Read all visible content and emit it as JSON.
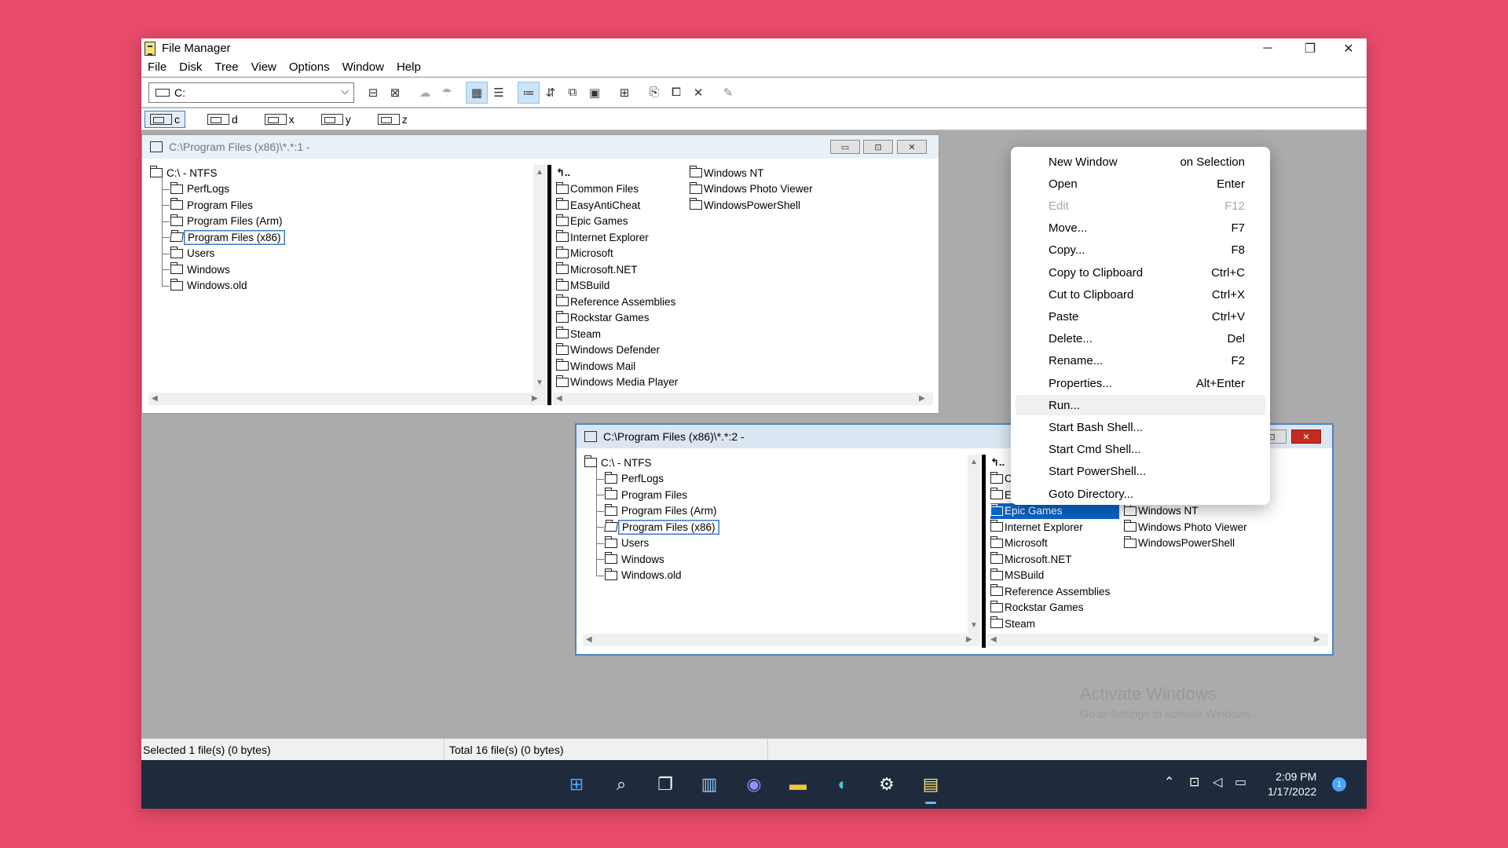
{
  "app": {
    "title": "File Manager",
    "window_controls": {
      "minimize": "─",
      "maximize": "❐",
      "close": "✕"
    }
  },
  "menubar": [
    "File",
    "Disk",
    "Tree",
    "View",
    "Options",
    "Window",
    "Help"
  ],
  "toolbar": {
    "drive_value": "C:",
    "buttons": [
      "connect-drive-icon",
      "disconnect-drive-icon",
      "share-icon",
      "stop-share-icon",
      "by-name-icon",
      "all-details-icon",
      "sort-by-name-icon",
      "sort-by-type-icon",
      "find-icon",
      "properties-icon",
      "new-window-icon",
      "copy-icon",
      "move-icon",
      "delete-icon",
      "run-icon"
    ]
  },
  "drives": [
    "c",
    "d",
    "x",
    "y",
    "z"
  ],
  "window1": {
    "title": "C:\\Program Files (x86)\\*.*:1 -",
    "tree": [
      {
        "label": "C:\\ - NTFS",
        "level": 0
      },
      {
        "label": "PerfLogs",
        "level": 1
      },
      {
        "label": "Program Files",
        "level": 1
      },
      {
        "label": "Program Files (Arm)",
        "level": 1
      },
      {
        "label": "Program Files (x86)",
        "level": 1,
        "selected": true
      },
      {
        "label": "Users",
        "level": 1
      },
      {
        "label": "Windows",
        "level": 1
      },
      {
        "label": "Windows.old",
        "level": 1
      }
    ],
    "files_col1": [
      "Common Files",
      "EasyAntiCheat",
      "Epic Games",
      "Internet Explorer",
      "Microsoft",
      "Microsoft.NET",
      "MSBuild",
      "Reference Assemblies",
      "Rockstar Games",
      "Steam",
      "Windows Defender",
      "Windows Mail",
      "Windows Media Player"
    ],
    "files_col2": [
      "Windows NT",
      "Windows Photo Viewer",
      "WindowsPowerShell"
    ]
  },
  "window2": {
    "title": "C:\\Program Files (x86)\\*.*:2 -",
    "tree": [
      {
        "label": "C:\\ - NTFS",
        "level": 0
      },
      {
        "label": "PerfLogs",
        "level": 1
      },
      {
        "label": "Program Files",
        "level": 1
      },
      {
        "label": "Program Files (Arm)",
        "level": 1
      },
      {
        "label": "Program Files (x86)",
        "level": 1,
        "selected": true
      },
      {
        "label": "Users",
        "level": 1
      },
      {
        "label": "Windows",
        "level": 1
      },
      {
        "label": "Windows.old",
        "level": 1
      }
    ],
    "files_col1": [
      "C",
      "E",
      "Epic Games",
      "Internet Explorer",
      "Microsoft",
      "Microsoft.NET",
      "MSBuild",
      "Reference Assemblies",
      "Rockstar Games",
      "Steam"
    ],
    "files_col2": [
      "Windows NT",
      "Windows Photo Viewer",
      "WindowsPowerShell"
    ],
    "highlighted": "Epic Games"
  },
  "context_menu": [
    {
      "label": "New Window",
      "shortcut": "on Selection"
    },
    {
      "label": "Open",
      "shortcut": "Enter"
    },
    {
      "label": "Edit",
      "shortcut": "F12",
      "disabled": true
    },
    {
      "label": "Move...",
      "shortcut": "F7"
    },
    {
      "label": "Copy...",
      "shortcut": "F8"
    },
    {
      "label": "Copy to Clipboard",
      "shortcut": "Ctrl+C"
    },
    {
      "label": "Cut to Clipboard",
      "shortcut": "Ctrl+X"
    },
    {
      "label": "Paste",
      "shortcut": "Ctrl+V"
    },
    {
      "label": "Delete...",
      "shortcut": "Del"
    },
    {
      "label": "Rename...",
      "shortcut": "F2"
    },
    {
      "label": "Properties...",
      "shortcut": "Alt+Enter"
    },
    {
      "label": "Run...",
      "shortcut": "",
      "hover": true
    },
    {
      "label": "Start Bash Shell...",
      "shortcut": ""
    },
    {
      "label": "Start Cmd Shell...",
      "shortcut": ""
    },
    {
      "label": "Start PowerShell...",
      "shortcut": ""
    },
    {
      "label": "Goto Directory...",
      "shortcut": ""
    }
  ],
  "status": {
    "selected": "Selected 1 file(s) (0 bytes)",
    "total": "Total 16 file(s) (0 bytes)"
  },
  "watermark": {
    "line1": "Activate Windows",
    "line2": "Go to Settings to activate Windows."
  },
  "taskbar": {
    "apps": [
      "start-icon",
      "search-icon",
      "task-view-icon",
      "widgets-icon",
      "chat-icon",
      "file-explorer-icon",
      "edge-icon",
      "steam-icon",
      "file-manager-icon"
    ],
    "time": "2:09 PM",
    "date": "1/17/2022",
    "notifications": "1"
  }
}
